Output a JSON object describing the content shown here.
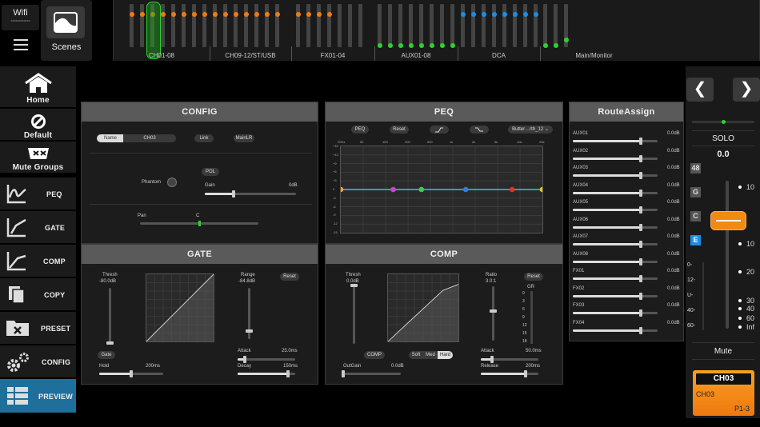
{
  "wifi": {
    "label": "Wifi",
    "ssid": "xxxxxxxxxxxx"
  },
  "scenes_label": "Scenes",
  "overview": {
    "groups": [
      "CH01-08",
      "CH09-12/ST/USB",
      "FX01-04",
      "AUX01-08",
      "DCA",
      "Main/Monitor"
    ],
    "colors": {
      "orange": "#f07a10",
      "green": "#2ed12e",
      "blue": "#1a8ee6"
    }
  },
  "nav": [
    {
      "label": "Home",
      "icon": "home-icon"
    },
    {
      "label": "Default",
      "icon": "default-icon"
    },
    {
      "label": "Mute Groups",
      "icon": "mute-groups-icon"
    },
    {
      "label": "PEQ",
      "icon": "peq-icon"
    },
    {
      "label": "GATE",
      "icon": "gate-icon"
    },
    {
      "label": "COMP",
      "icon": "comp-icon"
    },
    {
      "label": "COPY",
      "icon": "copy-icon"
    },
    {
      "label": "PRESET",
      "icon": "preset-icon"
    },
    {
      "label": "CONFIG",
      "icon": "config-icon"
    },
    {
      "label": "PREVIEW",
      "icon": "preview-icon"
    }
  ],
  "config": {
    "title": "CONFIG",
    "name_label": "Name",
    "name_value": "CH03",
    "link": "Link",
    "mainlr": "MainLR",
    "pol": "POL",
    "phantom": "Phantom",
    "gain_label": "Gain",
    "gain_value": "0dB",
    "gain_level": 0.32,
    "pan_label": "Pan",
    "pan_value": "C",
    "pan_level": 0.5
  },
  "peq": {
    "title": "PEQ",
    "peq_btn": "PEQ",
    "reset": "Reset",
    "filter_type": "Butter…rth_12",
    "band_colors": [
      "#f0a020",
      "#d040d0",
      "#30d050",
      "#2a7ee6",
      "#e03030",
      "#f0c020"
    ],
    "x_ticks": [
      "20Hz",
      "50",
      "100",
      "200",
      "500",
      "1k",
      "2k",
      "5k",
      "10k",
      "20k"
    ],
    "y_ticks": [
      "+15",
      "+12",
      "+9",
      "+6",
      "+3",
      "0",
      "-3",
      "-6",
      "-9",
      "-12",
      "-15"
    ]
  },
  "gate": {
    "title": "GATE",
    "thresh_label": "Thresh",
    "thresh_value": "-80.0dB",
    "range_label": "Range",
    "range_value": "-84.8dB",
    "reset": "Reset",
    "gate_btn": "Gate",
    "attack_label": "Attack",
    "attack_value": "25.0ms",
    "hold_label": "Hold",
    "hold_value": "200ms",
    "decay_label": "Decay",
    "decay_value": "150ms",
    "thresh_level": 0.02,
    "range_level": 0.15,
    "attack_level": 0.12,
    "hold_level": 0.5,
    "decay_level": 0.88
  },
  "comp": {
    "title": "COMP",
    "thresh_label": "Thresh",
    "thresh_value": "0.0dB",
    "ratio_label": "Ratio",
    "ratio_value": "3.0:1",
    "reset": "Reset",
    "gr_label": "GR",
    "comp_btn": "COMP",
    "soft": "Soft",
    "med": "Med",
    "hard": "Hard",
    "attack_label": "Attack",
    "attack_value": "50.0ms",
    "outgain_label": "OutGain",
    "outgain_value": "0.0dB",
    "release_label": "Release",
    "release_value": "200ms",
    "gr_ticks": [
      "0",
      "3",
      "6",
      "9",
      "12",
      "15",
      "18"
    ],
    "thresh_level": 0.98,
    "ratio_level": 0.55,
    "attack_level": 0.2,
    "outgain_level": 0.0,
    "release_level": 0.78
  },
  "route": {
    "title": "RouteAssign",
    "items": [
      {
        "name": "AUX01",
        "value": "0.0dB"
      },
      {
        "name": "AUX02",
        "value": "0.0dB"
      },
      {
        "name": "AUX03",
        "value": "0.0dB"
      },
      {
        "name": "AUX04",
        "value": "0.0dB"
      },
      {
        "name": "AUX05",
        "value": "0.0dB"
      },
      {
        "name": "AUX06",
        "value": "0.0dB"
      },
      {
        "name": "AUX07",
        "value": "0.0dB"
      },
      {
        "name": "AUX08",
        "value": "0.0dB"
      },
      {
        "name": "FX01",
        "value": "0.0dB"
      },
      {
        "name": "FX02",
        "value": "0.0dB"
      },
      {
        "name": "FX03",
        "value": "0.0dB"
      },
      {
        "name": "FX04",
        "value": "0.0dB"
      }
    ],
    "level": 0.8
  },
  "channel": {
    "prev": "❮",
    "next": "❯",
    "solo": "SOLO",
    "value": "0.0",
    "b48": "48",
    "g": "G",
    "c": "C",
    "e": "E",
    "fader_scale": [
      "10",
      "0",
      "10",
      "20",
      "30",
      "40",
      "60",
      "Inf"
    ],
    "meter_scale": [
      "0-",
      "12-",
      "U-",
      "40-",
      "60-"
    ],
    "mute": "Mute",
    "name": "CH03",
    "name2": "CH03",
    "tag": "P1-3",
    "fader_level": 0.73,
    "accent": "#f08a10"
  }
}
